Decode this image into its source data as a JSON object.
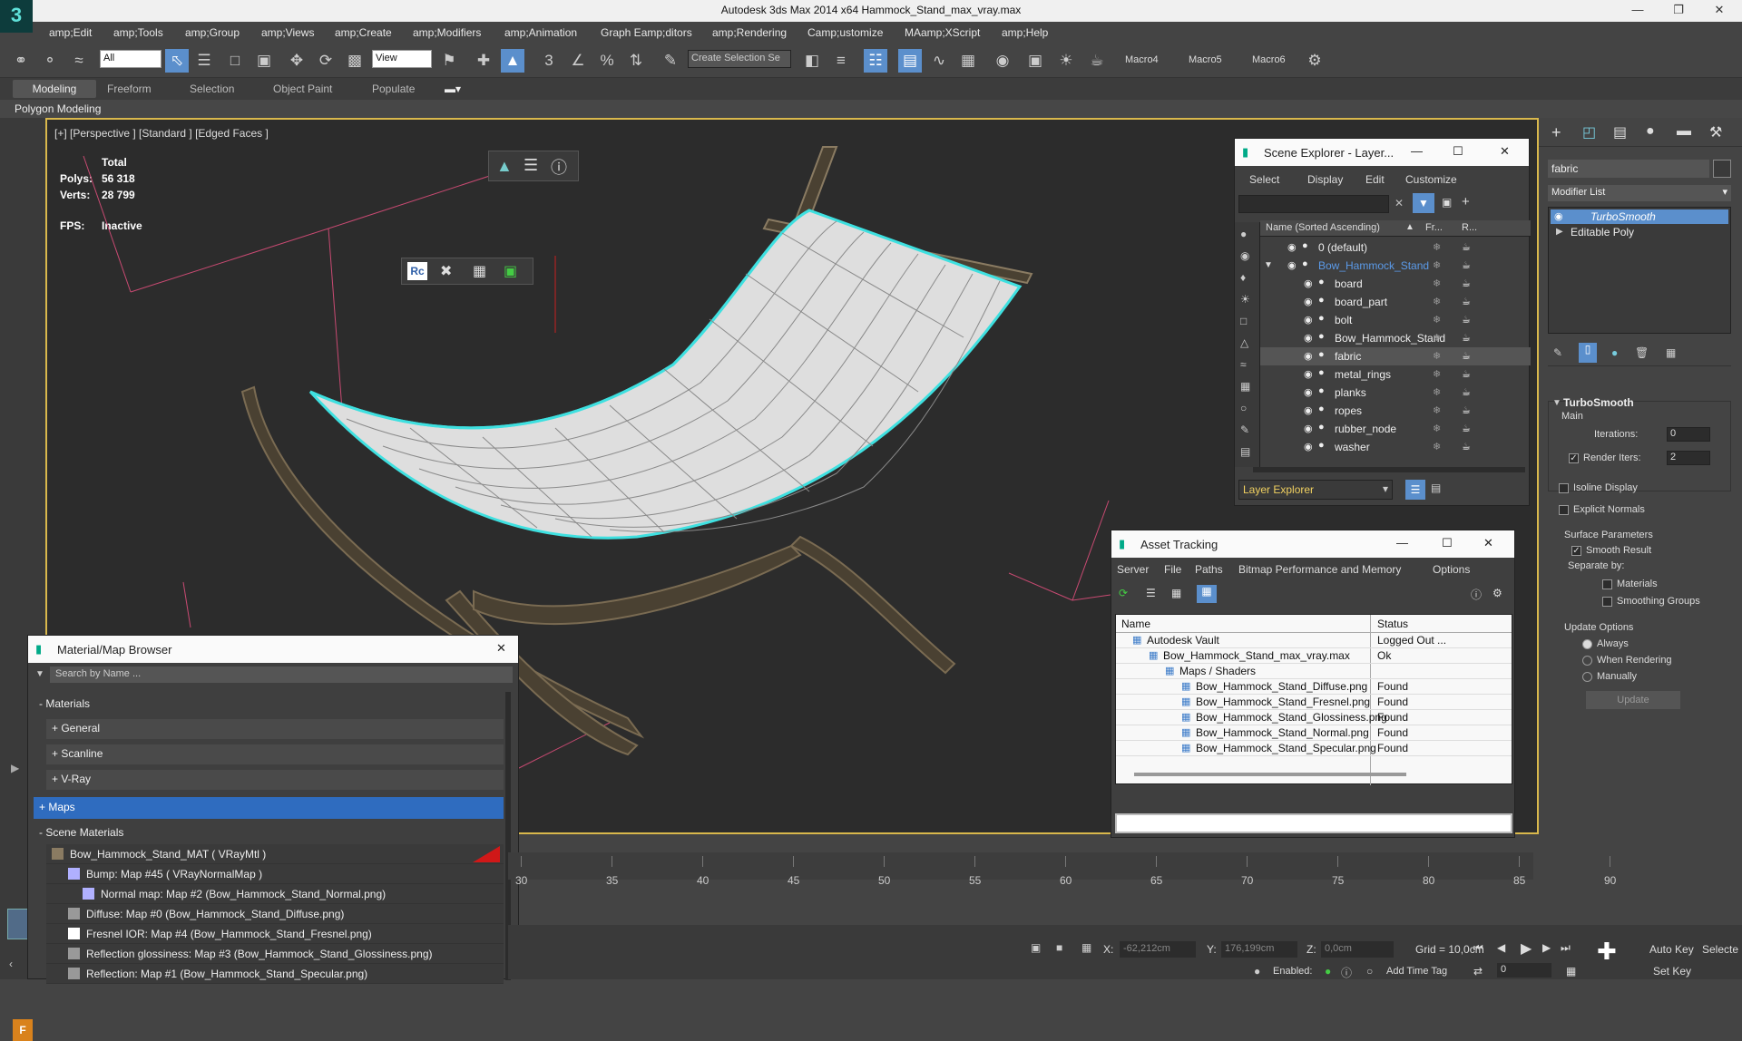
{
  "app": {
    "title": "Autodesk 3ds Max  2014 x64     Hammock_Stand_max_vray.max",
    "logo": "3ds-max-logo"
  },
  "menu": [
    "amp;Edit",
    "amp;Tools",
    "amp;Group",
    "amp;Views",
    "amp;Create",
    "amp;Modifiers",
    "amp;Animation",
    "Graph Eamp;ditors",
    "amp;Rendering",
    "Camp;ustomize",
    "MAamp;XScript",
    "amp;Help"
  ],
  "toolbar": {
    "selection_filter": "All",
    "ref_coord": "View",
    "named_selection": "Create Selection Se",
    "macros": [
      "Macro4",
      "Macro5",
      "Macro6"
    ]
  },
  "ribbon": {
    "tabs": [
      "Modeling",
      "Freeform",
      "Selection",
      "Object Paint",
      "Populate"
    ],
    "sublabel": "Polygon Modeling"
  },
  "viewport": {
    "label": "[+] [Perspective ] [Standard ] [Edged Faces ]",
    "stats": {
      "total_label": "Total",
      "polys_label": "Polys:",
      "polys": "56 318",
      "verts_label": "Verts:",
      "verts": "28 799",
      "fps_label": "FPS:",
      "fps": "Inactive"
    }
  },
  "scene_explorer": {
    "title": "Scene Explorer - Layer...",
    "menu": [
      "Select",
      "Display",
      "Edit",
      "Customize"
    ],
    "columns": {
      "name": "Name (Sorted Ascending)",
      "fr": "Fr...",
      "r": "R..."
    },
    "rows": [
      {
        "name": "0 (default)",
        "level": 0
      },
      {
        "name": "Bow_Hammock_Stand",
        "level": 0
      },
      {
        "name": "board",
        "level": 1
      },
      {
        "name": "board_part",
        "level": 1
      },
      {
        "name": "bolt",
        "level": 1
      },
      {
        "name": "Bow_Hammock_Stand",
        "level": 1
      },
      {
        "name": "fabric",
        "level": 1
      },
      {
        "name": "metal_rings",
        "level": 1
      },
      {
        "name": "planks",
        "level": 1
      },
      {
        "name": "ropes",
        "level": 1
      },
      {
        "name": "rubber_node",
        "level": 1
      },
      {
        "name": "washer",
        "level": 1
      }
    ],
    "footer": "Layer Explorer"
  },
  "asset_tracking": {
    "title": "Asset Tracking",
    "menu": [
      "Server",
      "File",
      "Paths",
      "Bitmap Performance and Memory",
      "Options"
    ],
    "columns": {
      "name": "Name",
      "status": "Status"
    },
    "rows": [
      {
        "name": "Autodesk Vault",
        "status": "Logged Out ...",
        "level": 0
      },
      {
        "name": "Bow_Hammock_Stand_max_vray.max",
        "status": "Ok",
        "level": 1
      },
      {
        "name": "Maps / Shaders",
        "status": "",
        "level": 2
      },
      {
        "name": "Bow_Hammock_Stand_Diffuse.png",
        "status": "Found",
        "level": 3
      },
      {
        "name": "Bow_Hammock_Stand_Fresnel.png",
        "status": "Found",
        "level": 3
      },
      {
        "name": "Bow_Hammock_Stand_Glossiness.png",
        "status": "Found",
        "level": 3
      },
      {
        "name": "Bow_Hammock_Stand_Normal.png",
        "status": "Found",
        "level": 3
      },
      {
        "name": "Bow_Hammock_Stand_Specular.png",
        "status": "Found",
        "level": 3
      }
    ]
  },
  "material_browser": {
    "title": "Material/Map Browser",
    "search_placeholder": "Search by Name ...",
    "groups": {
      "materials": "- Materials",
      "general": "+ General",
      "scanline": "+ Scanline",
      "vray": "+ V-Ray",
      "maps": "+ Maps",
      "scene_materials": "- Scene Materials"
    },
    "scene_items": [
      "Bow_Hammock_Stand_MAT  ( VRayMtl )",
      "Bump: Map #45  ( VRayNormalMap )",
      "Normal map: Map #2 (Bow_Hammock_Stand_Normal.png)",
      "Diffuse: Map #0 (Bow_Hammock_Stand_Diffuse.png)",
      "Fresnel IOR: Map #4 (Bow_Hammock_Stand_Fresnel.png)",
      "Reflection glossiness: Map #3 (Bow_Hammock_Stand_Glossiness.png)",
      "Reflection: Map #1 (Bow_Hammock_Stand_Specular.png)"
    ]
  },
  "modifier_panel": {
    "object_name": "fabric",
    "modifier_list": "Modifier List",
    "stack": [
      "TurboSmooth",
      "Editable Poly"
    ],
    "rollout_title": "TurboSmooth",
    "main_label": "Main",
    "iterations_label": "Iterations:",
    "iterations": "0",
    "render_iters_label": "Render Iters:",
    "render_iters": "2",
    "isoline": "Isoline Display",
    "explicit_normals": "Explicit Normals",
    "surface_params": "Surface Parameters",
    "smooth_result": "Smooth Result",
    "separate_by": "Separate by:",
    "materials": "Materials",
    "smoothing_groups": "Smoothing Groups",
    "update_options": "Update Options",
    "always": "Always",
    "when_rendering": "When Rendering",
    "manually": "Manually",
    "update_button": "Update"
  },
  "timeline": {
    "ticks": [
      "30",
      "35",
      "40",
      "45",
      "50",
      "55",
      "60",
      "65",
      "70",
      "75",
      "80",
      "85",
      "90"
    ]
  },
  "statusbar": {
    "x_label": "X:",
    "x_value": "-62,212cm",
    "y_label": "Y:",
    "y_value": "176,199cm",
    "z_label": "Z:",
    "z_value": "0,0cm",
    "grid": "Grid = 10,0cm",
    "auto_key": "Auto Key",
    "selected": "Selecte",
    "set_key": "Set Key",
    "frame": "0",
    "enabled": "Enabled:",
    "add_time_tag": "Add Time Tag"
  },
  "colors": {
    "accent": "#5b8fcc",
    "viewport_border": "#d9b84c",
    "selection_outline": "#3ee0e0",
    "layer_text": "#f0d060"
  }
}
